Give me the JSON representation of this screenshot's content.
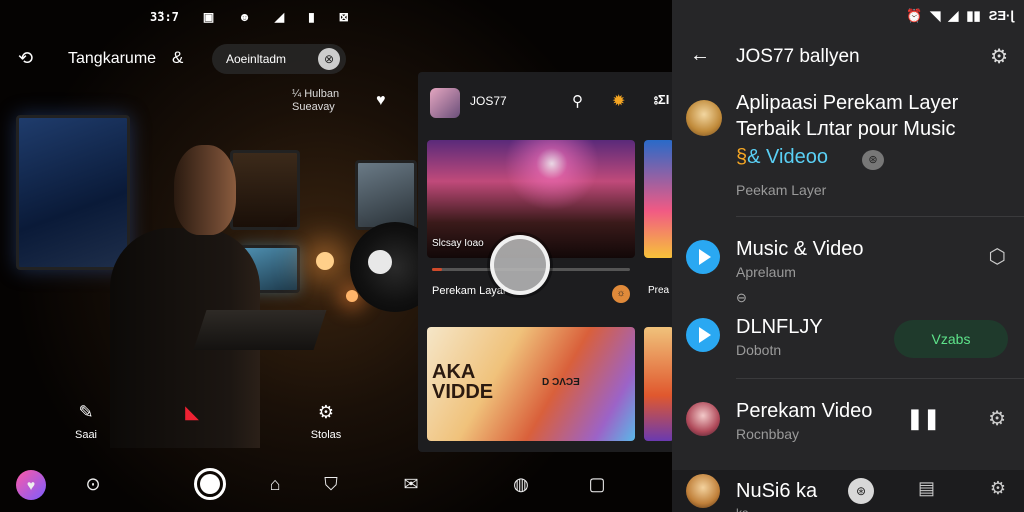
{
  "status_left": {
    "time": "3̃3:7",
    "icons": [
      "image-icon",
      "face-icon",
      "signal-icon",
      "battery-icon",
      "grid-icon"
    ]
  },
  "camera": {
    "title": "Tangkarume",
    "account": "Aoeinltadm",
    "account_badge": "⊗",
    "overlay_line1": "¼ Hulban",
    "overlay_line2": "Sueavay",
    "tools": {
      "edit": "Saai",
      "record": "",
      "settings": "Stolas"
    }
  },
  "gallery": {
    "title": "JOS77",
    "more": "⦂ΣI",
    "card1_caption": "Slcsay Ioao",
    "card1_progress": 0.05,
    "row_label": "Perekam Layar",
    "row_label_side": "Prea",
    "card2_title_l1": "AKA",
    "card2_title_l2": "VIDDE",
    "card2_overlay": "D ƆɅƆƎ"
  },
  "status_right": {
    "time": "ƧƎ·ɭ"
  },
  "list": {
    "title": "JOS77 ballyen",
    "feature": {
      "title": "Aplipaasi Perekam Layer Terbaik Lлtar pour Music",
      "sub_emoji": "§",
      "sub": "& Videoo",
      "caption": "Peekam Layer"
    },
    "rows": [
      {
        "title": "Music & Video",
        "sub": "Aprelaum",
        "small": "⊖"
      },
      {
        "title": "DLNFLJY",
        "sub": "Dobotn",
        "pill": "Vzabs"
      },
      {
        "title": "Perekam Video",
        "sub": "Rocnbbay"
      },
      {
        "title": "NuSi6 ka",
        "sub": "ka"
      }
    ]
  },
  "colors": {
    "accent_blue": "#2aa8f2",
    "accent_green": "#5ee38a",
    "cyan_text": "#5ad0f5"
  }
}
